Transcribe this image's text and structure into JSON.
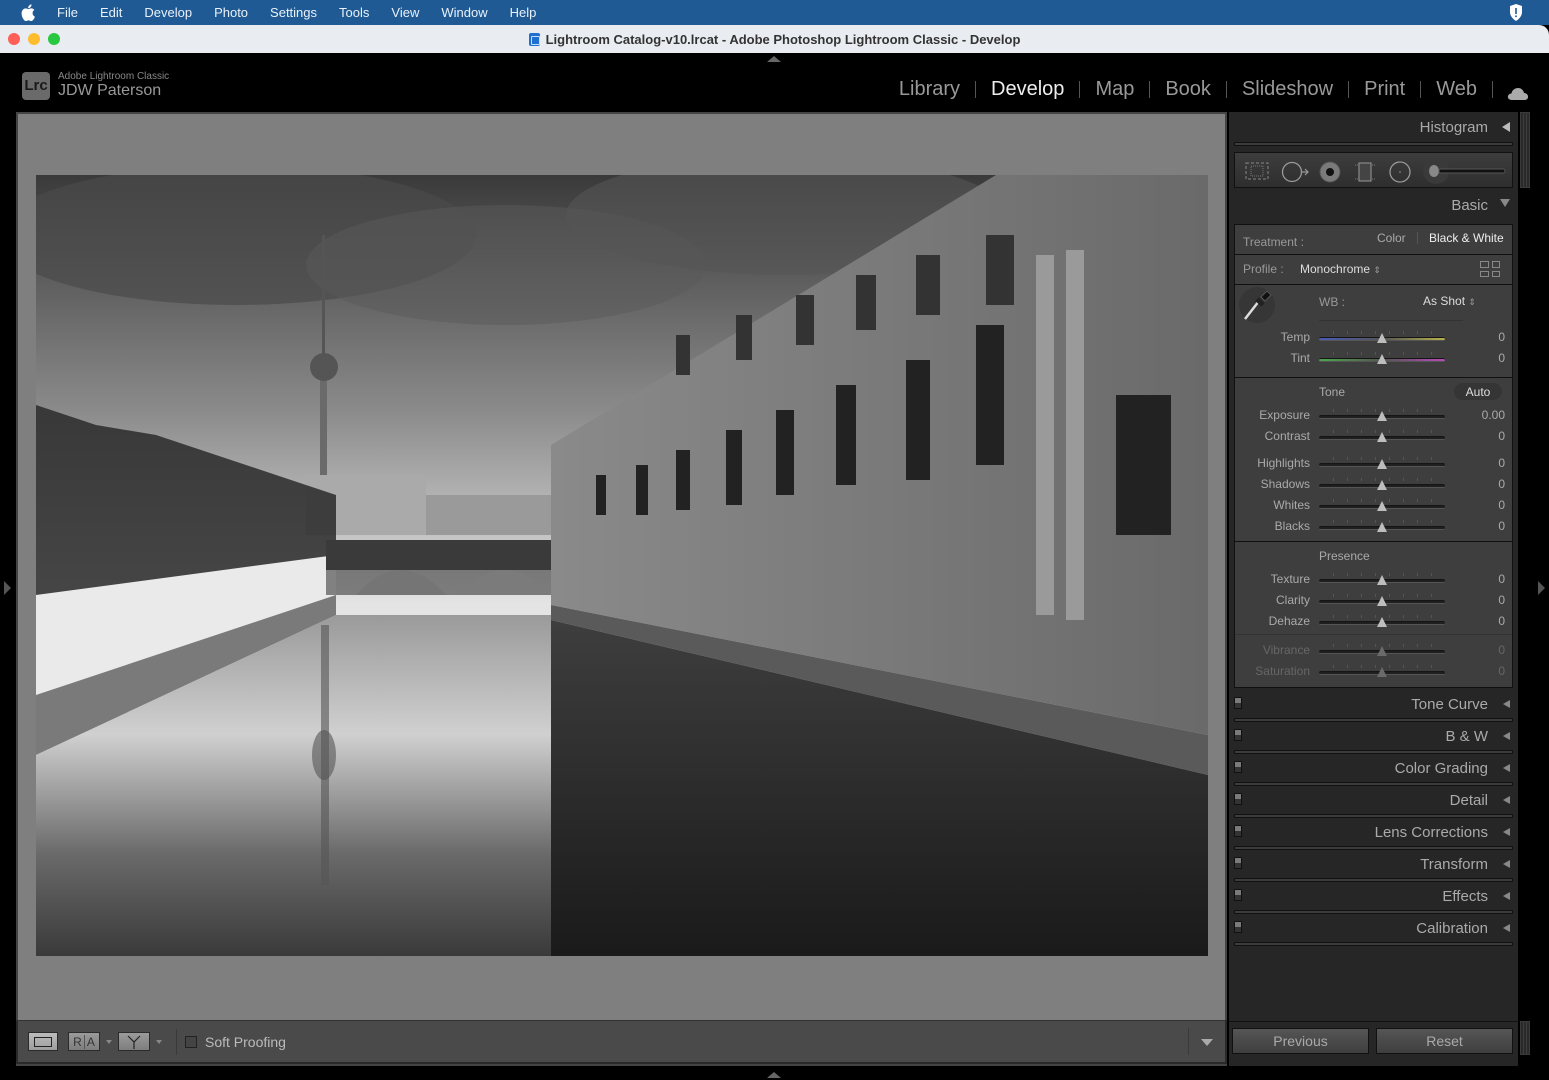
{
  "menubar": {
    "app_name": "Lightroom Classic",
    "items": [
      "File",
      "Edit",
      "Develop",
      "Photo",
      "Settings",
      "Tools",
      "View",
      "Window",
      "Help"
    ]
  },
  "window": {
    "title": "Lightroom Catalog-v10.lrcat - Adobe Photoshop Lightroom Classic - Develop"
  },
  "identity": {
    "badge": "Lrc",
    "product": "Adobe Lightroom Classic",
    "user": "JDW Paterson"
  },
  "modules": {
    "items": [
      "Library",
      "Develop",
      "Map",
      "Book",
      "Slideshow",
      "Print",
      "Web"
    ],
    "active": "Develop"
  },
  "toolbar": {
    "view_mode_icon": "loupe-view-icon",
    "before_after_labels": [
      "R",
      "A"
    ],
    "before_after_split_icon": "before-after-split-icon",
    "soft_proofing_label": "Soft Proofing",
    "soft_proofing_checked": false
  },
  "right_panel": {
    "histogram_label": "Histogram",
    "tools": [
      "crop-overlay-icon",
      "spot-removal-icon",
      "red-eye-icon",
      "graduated-filter-icon",
      "radial-filter-icon",
      "adjustment-brush-icon"
    ],
    "basic": {
      "label": "Basic",
      "treatment_label": "Treatment :",
      "treatment_options": [
        "Color",
        "Black & White"
      ],
      "treatment_selected": "Black & White",
      "profile_label": "Profile :",
      "profile_value": "Monochrome",
      "wb_label": "WB :",
      "wb_value": "As Shot",
      "wb_sliders": [
        {
          "label": "Temp",
          "value": "0",
          "position": 0.5
        },
        {
          "label": "Tint",
          "value": "0",
          "position": 0.5
        }
      ],
      "tone_label": "Tone",
      "auto_label": "Auto",
      "tone_sliders": [
        {
          "label": "Exposure",
          "value": "0.00",
          "position": 0.5
        },
        {
          "label": "Contrast",
          "value": "0",
          "position": 0.5
        },
        {
          "label": "Highlights",
          "value": "0",
          "position": 0.5
        },
        {
          "label": "Shadows",
          "value": "0",
          "position": 0.5
        },
        {
          "label": "Whites",
          "value": "0",
          "position": 0.5
        },
        {
          "label": "Blacks",
          "value": "0",
          "position": 0.5
        }
      ],
      "presence_label": "Presence",
      "presence_sliders": [
        {
          "label": "Texture",
          "value": "0",
          "position": 0.5
        },
        {
          "label": "Clarity",
          "value": "0",
          "position": 0.5
        },
        {
          "label": "Dehaze",
          "value": "0",
          "position": 0.5
        }
      ],
      "color_sliders_disabled": [
        {
          "label": "Vibrance",
          "value": "0",
          "position": 0.5
        },
        {
          "label": "Saturation",
          "value": "0",
          "position": 0.5
        }
      ]
    },
    "collapsed_sections": [
      "Tone Curve",
      "B & W",
      "Color Grading",
      "Detail",
      "Lens Corrections",
      "Transform",
      "Effects",
      "Calibration"
    ],
    "previous_label": "Previous",
    "reset_label": "Reset"
  },
  "photo": {
    "description": "Black and white photo of the Bode Museum on the Spree river in Berlin with the TV tower and an arched bridge reflected in the water"
  },
  "colors": {
    "menubar_bg": "#1f5a94",
    "panel_bg": "#262626",
    "section_bg": "#3e3e3e",
    "canvas_bg": "#7f7f7f",
    "temp_left": "#4a5ab8",
    "temp_right": "#b8b24a",
    "tint_left": "#4aa84a",
    "tint_right": "#b84ab8"
  }
}
